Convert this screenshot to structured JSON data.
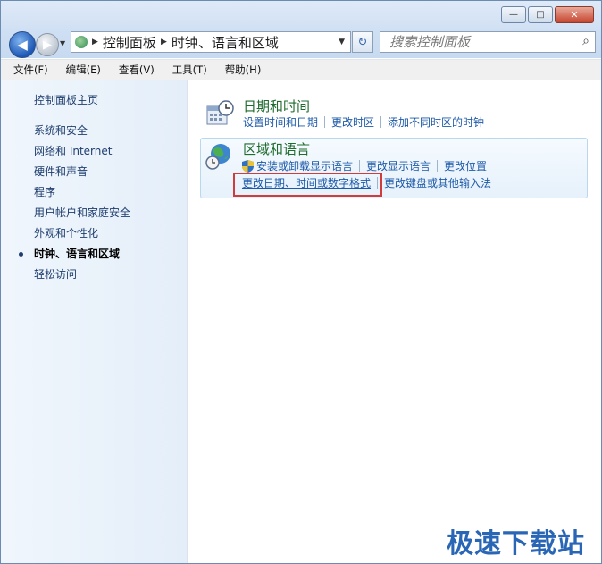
{
  "window": {
    "caption_buttons": {
      "minimize": "—",
      "maximize": "□",
      "close": "✕"
    }
  },
  "nav": {
    "back_icon": "arrow-left-icon",
    "forward_icon": "arrow-right-icon",
    "address": {
      "sep": "▶",
      "crumbs": [
        "控制面板",
        "时钟、语言和区域"
      ],
      "dropdown": "▼"
    },
    "refresh_glyph": "↻",
    "search": {
      "placeholder": "搜索控制面板",
      "icon": "⌕"
    }
  },
  "menubar": {
    "items": [
      "文件(F)",
      "编辑(E)",
      "查看(V)",
      "工具(T)",
      "帮助(H)"
    ]
  },
  "sidebar": {
    "home": "控制面板主页",
    "items": [
      {
        "label": "系统和安全"
      },
      {
        "label": "网络和 Internet"
      },
      {
        "label": "硬件和声音"
      },
      {
        "label": "程序"
      },
      {
        "label": "用户帐户和家庭安全"
      },
      {
        "label": "外观和个性化"
      },
      {
        "label": "时钟、语言和区域",
        "active": true
      },
      {
        "label": "轻松访问"
      }
    ]
  },
  "main": {
    "categories": [
      {
        "title": "日期和时间",
        "icon": "calendar-clock-icon",
        "links": [
          "设置时间和日期",
          "更改时区",
          "添加不同时区的时钟"
        ]
      },
      {
        "title": "区域和语言",
        "icon": "globe-clock-icon",
        "row1": [
          "安装或卸载显示语言",
          "更改显示语言",
          "更改位置"
        ],
        "row2": [
          "更改日期、时间或数字格式",
          "更改键盘或其他输入法"
        ]
      }
    ]
  },
  "watermark": "极速下载站",
  "colors": {
    "link": "#1e5aa8",
    "category_title": "#1f6c2e",
    "highlight_box": "#d13b3b"
  }
}
